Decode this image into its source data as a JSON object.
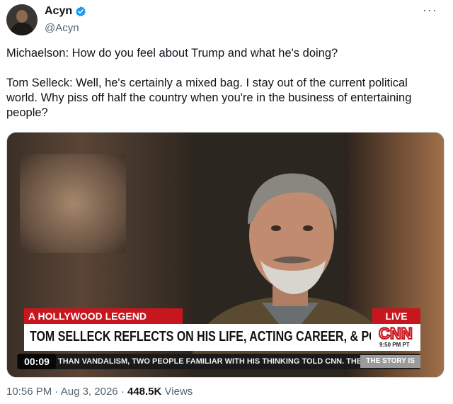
{
  "author": {
    "display_name": "Acyn",
    "handle": "@Acyn",
    "verified": true
  },
  "more_label": "···",
  "tweet": {
    "paragraphs": [
      "Michaelson: How do you feel about Trump and what he's doing?",
      "Tom Selleck: Well, he's certainly a mixed bag. I stay out of the current political world. Why piss off half the country when you're in the business of entertaining people?"
    ]
  },
  "video": {
    "timer": "00:09",
    "lower_third_label": "A HOLLYWOOD LEGEND",
    "live_label": "LIVE",
    "headline": "TOM SELLECK REFLECTS ON HIS LIFE, ACTING CAREER, & POLITICS",
    "network": "CNN",
    "time": "9:50 PM PT",
    "ticker": "THAN VANDALISM, TWO PEOPLE FAMILIAR WITH HIS THINKING TOLD CNN. THE",
    "ticker_tag": "THE STORY IS"
  },
  "meta": {
    "time": "10:56 PM",
    "date": "Aug 3, 2026",
    "separator": "·",
    "views_count": "448.5K",
    "views_label": "Views"
  },
  "colors": {
    "verified_badge": "#1d9bf0",
    "cnn_red": "#c8161e"
  }
}
